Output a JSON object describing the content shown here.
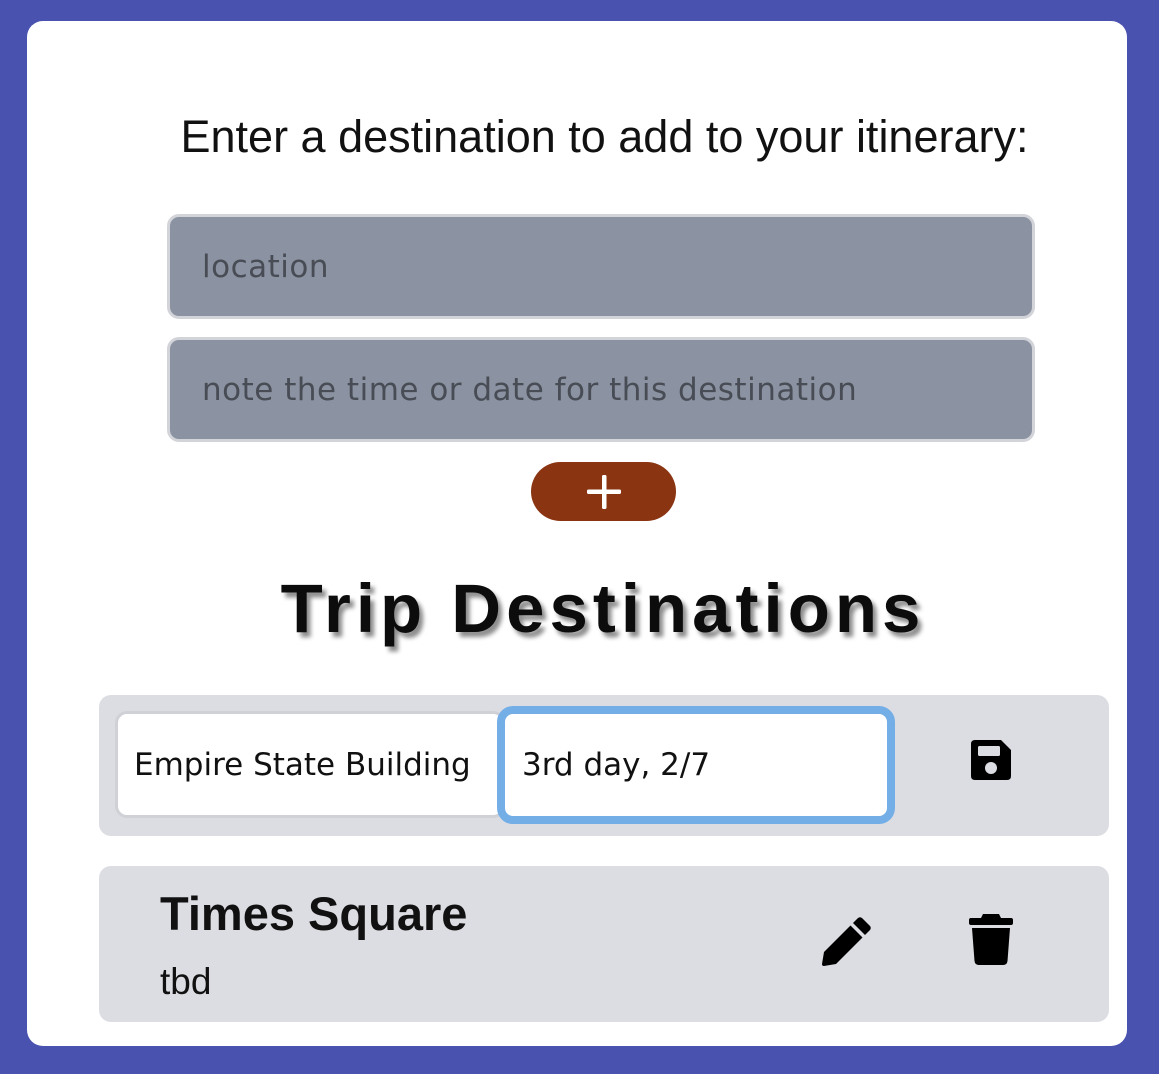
{
  "form": {
    "prompt": "Enter a destination to add to your itinerary:",
    "location_placeholder": "location",
    "note_placeholder": "note the time or date for this destination",
    "add_button_icon": "plus-icon"
  },
  "list": {
    "heading": "Trip Destinations",
    "editing_item": {
      "location_value": "Empire State Building",
      "note_value": "3rd day, 2/7",
      "save_icon": "floppy-disk-icon"
    },
    "items": [
      {
        "location": "Times Square",
        "note": "tbd",
        "edit_icon": "pencil-icon",
        "delete_icon": "trash-icon"
      }
    ]
  },
  "colors": {
    "background": "#4a52b0",
    "card": "#ffffff",
    "input_fill": "#8b92a1",
    "add_button": "#8a3412",
    "row_fill": "#dcdde2",
    "focus_ring": "#74aee6"
  }
}
